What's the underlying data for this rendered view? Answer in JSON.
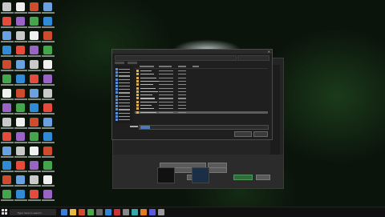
{
  "desktop": {
    "icon_colors": [
      "#c9c9c9",
      "#e64a3b",
      "#6aa1e0",
      "#2f8ad8",
      "#d04a2c",
      "#44a64b",
      "#f0f0f0",
      "#9a63c5"
    ]
  },
  "dialog": {
    "title_close_glyph": "✕",
    "filename_value": "",
    "accent": "#4d79b8"
  },
  "taskbar": {
    "search_placeholder": "Type here to search"
  },
  "colors": {
    "window_bg": "#242424",
    "dialog_bg": "#1f1f1f",
    "accent_green": "#2e6d3a"
  }
}
